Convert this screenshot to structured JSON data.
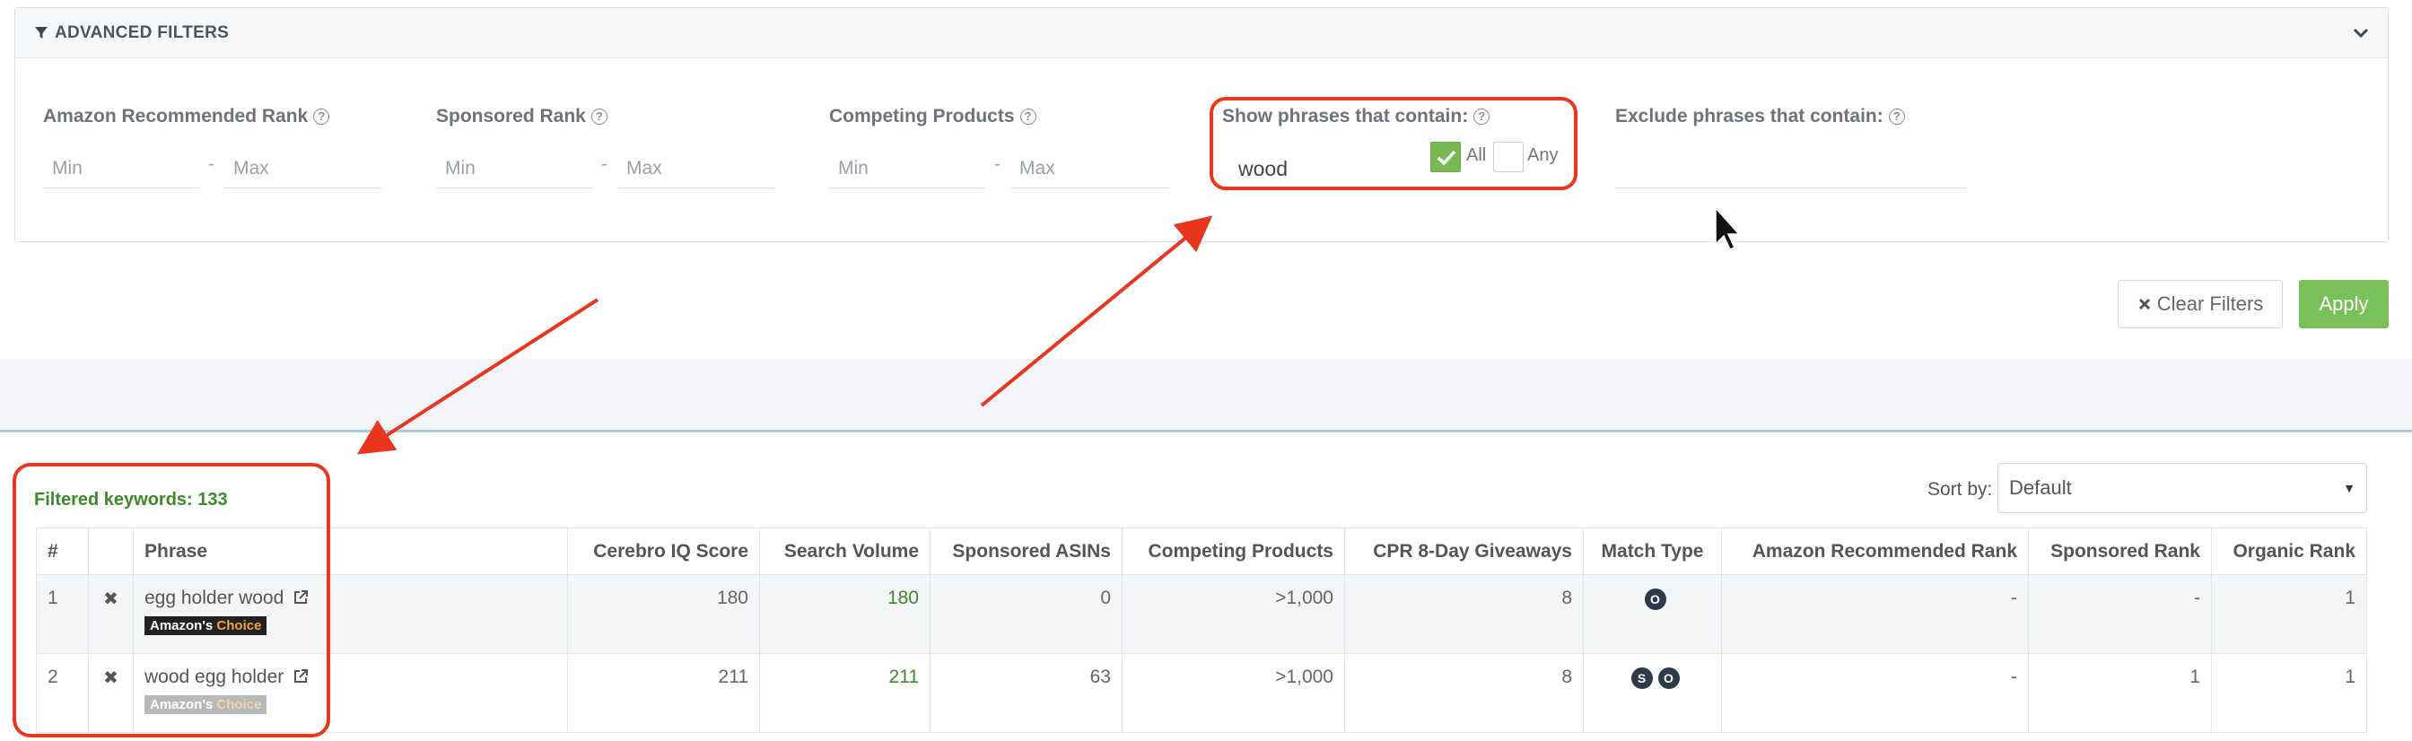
{
  "filters": {
    "title": "ADVANCED FILTERS",
    "amazon_rank_label": "Amazon Recommended Rank",
    "sponsored_rank_label": "Sponsored Rank",
    "competing_label": "Competing Products",
    "show_label": "Show phrases that contain:",
    "exclude_label": "Exclude phrases that contain:",
    "help_glyph": "?",
    "min_placeholder": "Min",
    "max_placeholder": "Max",
    "range_separator": "-",
    "show_value": "wood",
    "all_label": "All",
    "any_label": "Any",
    "all_checked": true,
    "any_checked": false
  },
  "actions": {
    "clear_label": "Clear Filters",
    "apply_label": "Apply"
  },
  "results": {
    "filtered_label": "Filtered keywords: 133",
    "sort_label": "Sort by:",
    "sort_value": "Default",
    "columns": [
      "#",
      "",
      "Phrase",
      "Cerebro IQ Score",
      "Search Volume",
      "Sponsored ASINs",
      "Competing Products",
      "CPR 8-Day Giveaways",
      "Match Type",
      "Amazon Recommended Rank",
      "Sponsored Rank",
      "Organic Rank"
    ],
    "rows": [
      {
        "n": "1",
        "phrase": "egg holder wood",
        "badge_a": "Amazon's",
        "badge_b": "Choice",
        "iq": "180",
        "sv": "180",
        "asins": "0",
        "competing": ">1,000",
        "cpr": "8",
        "m1": "",
        "m2": "O",
        "amz_rank": "-",
        "sp_rank": "-",
        "org_rank": "1"
      },
      {
        "n": "2",
        "phrase": "wood egg holder",
        "badge_a": "Amazon's",
        "badge_b": "Choice",
        "iq": "211",
        "sv": "211",
        "asins": "63",
        "competing": ">1,000",
        "cpr": "8",
        "m1": "S",
        "m2": "O",
        "amz_rank": "-",
        "sp_rank": "1",
        "org_rank": "1"
      }
    ]
  },
  "colors": {
    "annotation": "#e8361f",
    "apply": "#7ac05a",
    "green_text": "#3d8a2a",
    "checkbox_on": "#78b955"
  },
  "icons": {
    "header": "funnel-icon",
    "collapse": "chevron-down-icon",
    "clear": "close-icon",
    "remove": "remove-x-icon",
    "external": "external-link-icon",
    "pointer": "mouse-pointer-icon"
  }
}
